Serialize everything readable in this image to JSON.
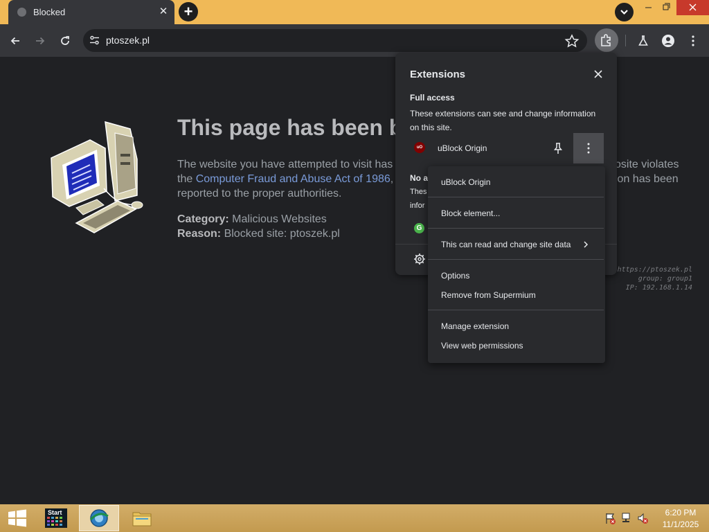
{
  "browser": {
    "tab": {
      "title": "Blocked"
    },
    "address_bar": {
      "url": "ptoszek.pl"
    }
  },
  "blocked_page": {
    "heading": "This page has been blocked",
    "paragraph_left_1": "The website you have attempted to visit has",
    "paragraph_left_2_prefix": "the ",
    "paragraph_link": "Computer Fraud and Abuse Act of 1986",
    "paragraph_left_2_suffix": ",",
    "paragraph_left_3": "reported to the proper authorities.",
    "paragraph_right_1": "osite violates",
    "paragraph_right_2": "ion has been",
    "category_label": "Category:",
    "category_value": "Malicious Websites",
    "reason_label": "Reason:",
    "reason_value": "Blocked site: ptoszek.pl",
    "debug_url": "https://ptoszek.pl",
    "debug_group": "group: group1",
    "debug_ip": "IP: 192.168.1.14"
  },
  "extensions_panel": {
    "title": "Extensions",
    "full_access_heading": "Full access",
    "full_access_desc": "These extensions can see and change information on this site.",
    "extension_name": "uBlock Origin",
    "extension_icon_text": "uO",
    "no_access_heading": "No a",
    "no_access_line1": "Thes",
    "no_access_line2": "infor",
    "green_icon_text": "G"
  },
  "context_menu": {
    "items": [
      "uBlock Origin",
      "Block element...",
      "This can read and change site data",
      "Options",
      "Remove from Supermium",
      "Manage extension",
      "View web permissions"
    ]
  },
  "taskbar": {
    "start_label": "Start",
    "time": "6:20 PM",
    "date": "11/1/2025"
  }
}
